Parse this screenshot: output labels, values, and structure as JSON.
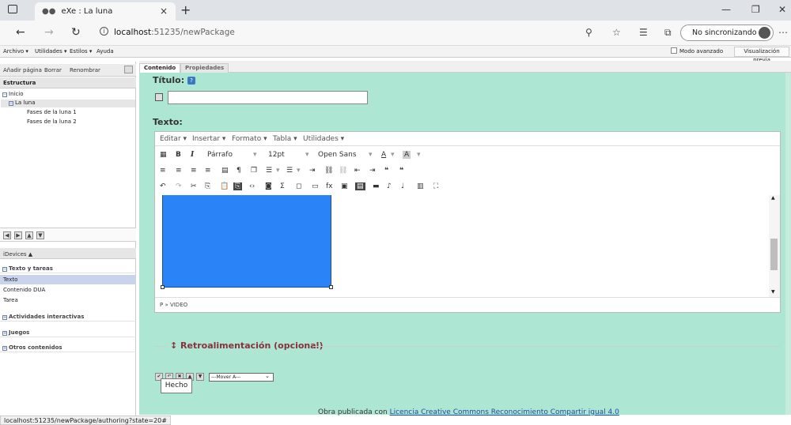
{
  "browser": {
    "tab_title": "eXe : La luna",
    "url_host": "localhost",
    "url_rest": ":51235/newPackage",
    "sync_label": "No sincronizando",
    "status_url": "localhost:51235/newPackage/authoring?state=20#"
  },
  "menubar": {
    "items": [
      "Archivo ▾",
      "Utilidades ▾",
      "Estilos ▾",
      "Ayuda"
    ],
    "modo_avanzado": "Modo avanzado",
    "preview": "Visualización previa"
  },
  "sidebar": {
    "toolbar": [
      "Añadir página",
      "Borrar",
      "Renombrar"
    ],
    "heading": "Estructura",
    "tree": [
      "Inicio",
      "La luna",
      "Fases de la luna 1",
      "Fases de la luna 2"
    ],
    "idevices_heading": "iDevices ▲",
    "categories": {
      "texto_tareas": "Texto y tareas",
      "actividades": "Actividades interactivas",
      "juegos": "Juegos",
      "otros": "Otros contenidos"
    },
    "idevices": [
      "Texto",
      "Contenido DUA",
      "Tarea"
    ]
  },
  "main": {
    "tabs": [
      "Contenido",
      "Propiedades"
    ],
    "titulo_label": "Título:",
    "texto_label": "Texto:",
    "editor_menu": [
      "Editar ▾",
      "Insertar ▾",
      "Formato ▾",
      "Tabla ▾",
      "Utilidades ▾"
    ],
    "toolbar1": {
      "paragraph": "Párrafo",
      "font_size": "12pt",
      "font_family": "Open Sans"
    },
    "status_path": "P » VIDEO",
    "feedback_label": "Retroalimentación (opcional)",
    "move_select": "---Mover A---",
    "tooltip": "Hecho",
    "footer_prefix": "Obra publicada con ",
    "footer_link": "Licencia Creative Commons Reconocimiento Compartir igual 4.0"
  },
  "colors": {
    "content_bg": "#aee6d4",
    "video_block": "#2a83f7",
    "feedback_text": "#8b2f3b"
  }
}
